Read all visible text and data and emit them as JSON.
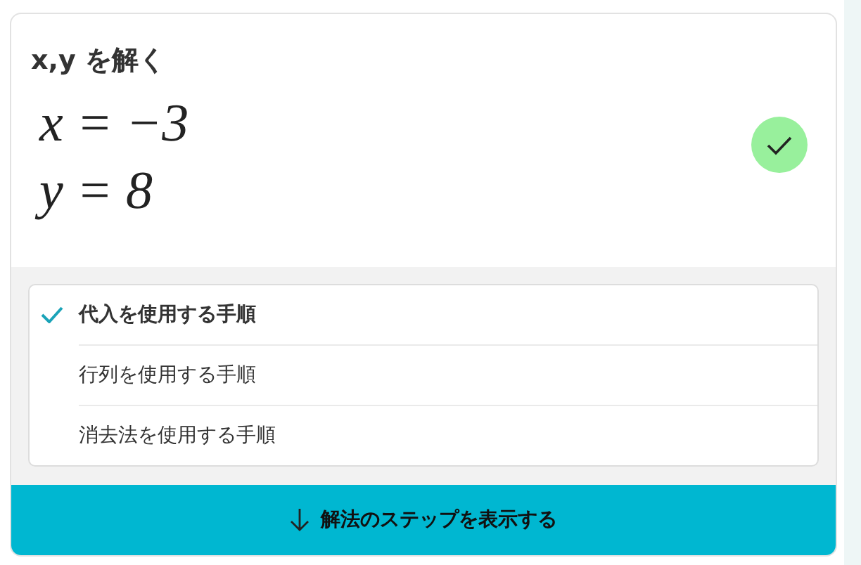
{
  "title": "x,y を解く",
  "solutions": [
    "x = −3",
    "y = 8"
  ],
  "verified": true,
  "methods": [
    {
      "label": "代入を使用する手順",
      "selected": true
    },
    {
      "label": "行列を使用する手順",
      "selected": false
    },
    {
      "label": "消去法を使用する手順",
      "selected": false
    }
  ],
  "steps_button": {
    "label": "解法のステップを表示する"
  }
}
